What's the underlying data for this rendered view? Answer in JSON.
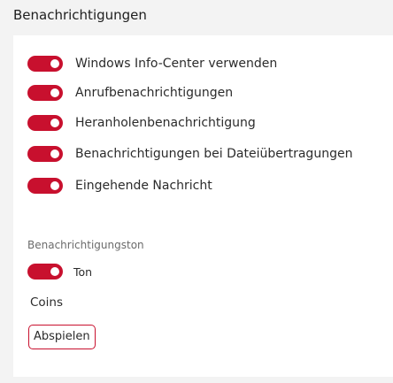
{
  "section": {
    "title": "Benachrichtigungen"
  },
  "toggles": [
    {
      "label": "Windows Info-Center verwenden",
      "checked": true
    },
    {
      "label": "Anrufbenachrichtigungen",
      "checked": true
    },
    {
      "label": "Heranholenbenachrichtigung",
      "checked": true
    },
    {
      "label": "Benachrichtigungen bei Dateiübertragungen",
      "checked": true
    },
    {
      "label": "Eingehende Nachricht",
      "checked": true
    }
  ],
  "sound": {
    "title": "Benachrichtigungston",
    "toggle_label": "Ton",
    "toggle_checked": true,
    "selected_sound": "Coins",
    "play_label": "Abspielen"
  },
  "colors": {
    "accent": "#c8102e",
    "background": "#f3f3f3",
    "panel": "#ffffff"
  }
}
